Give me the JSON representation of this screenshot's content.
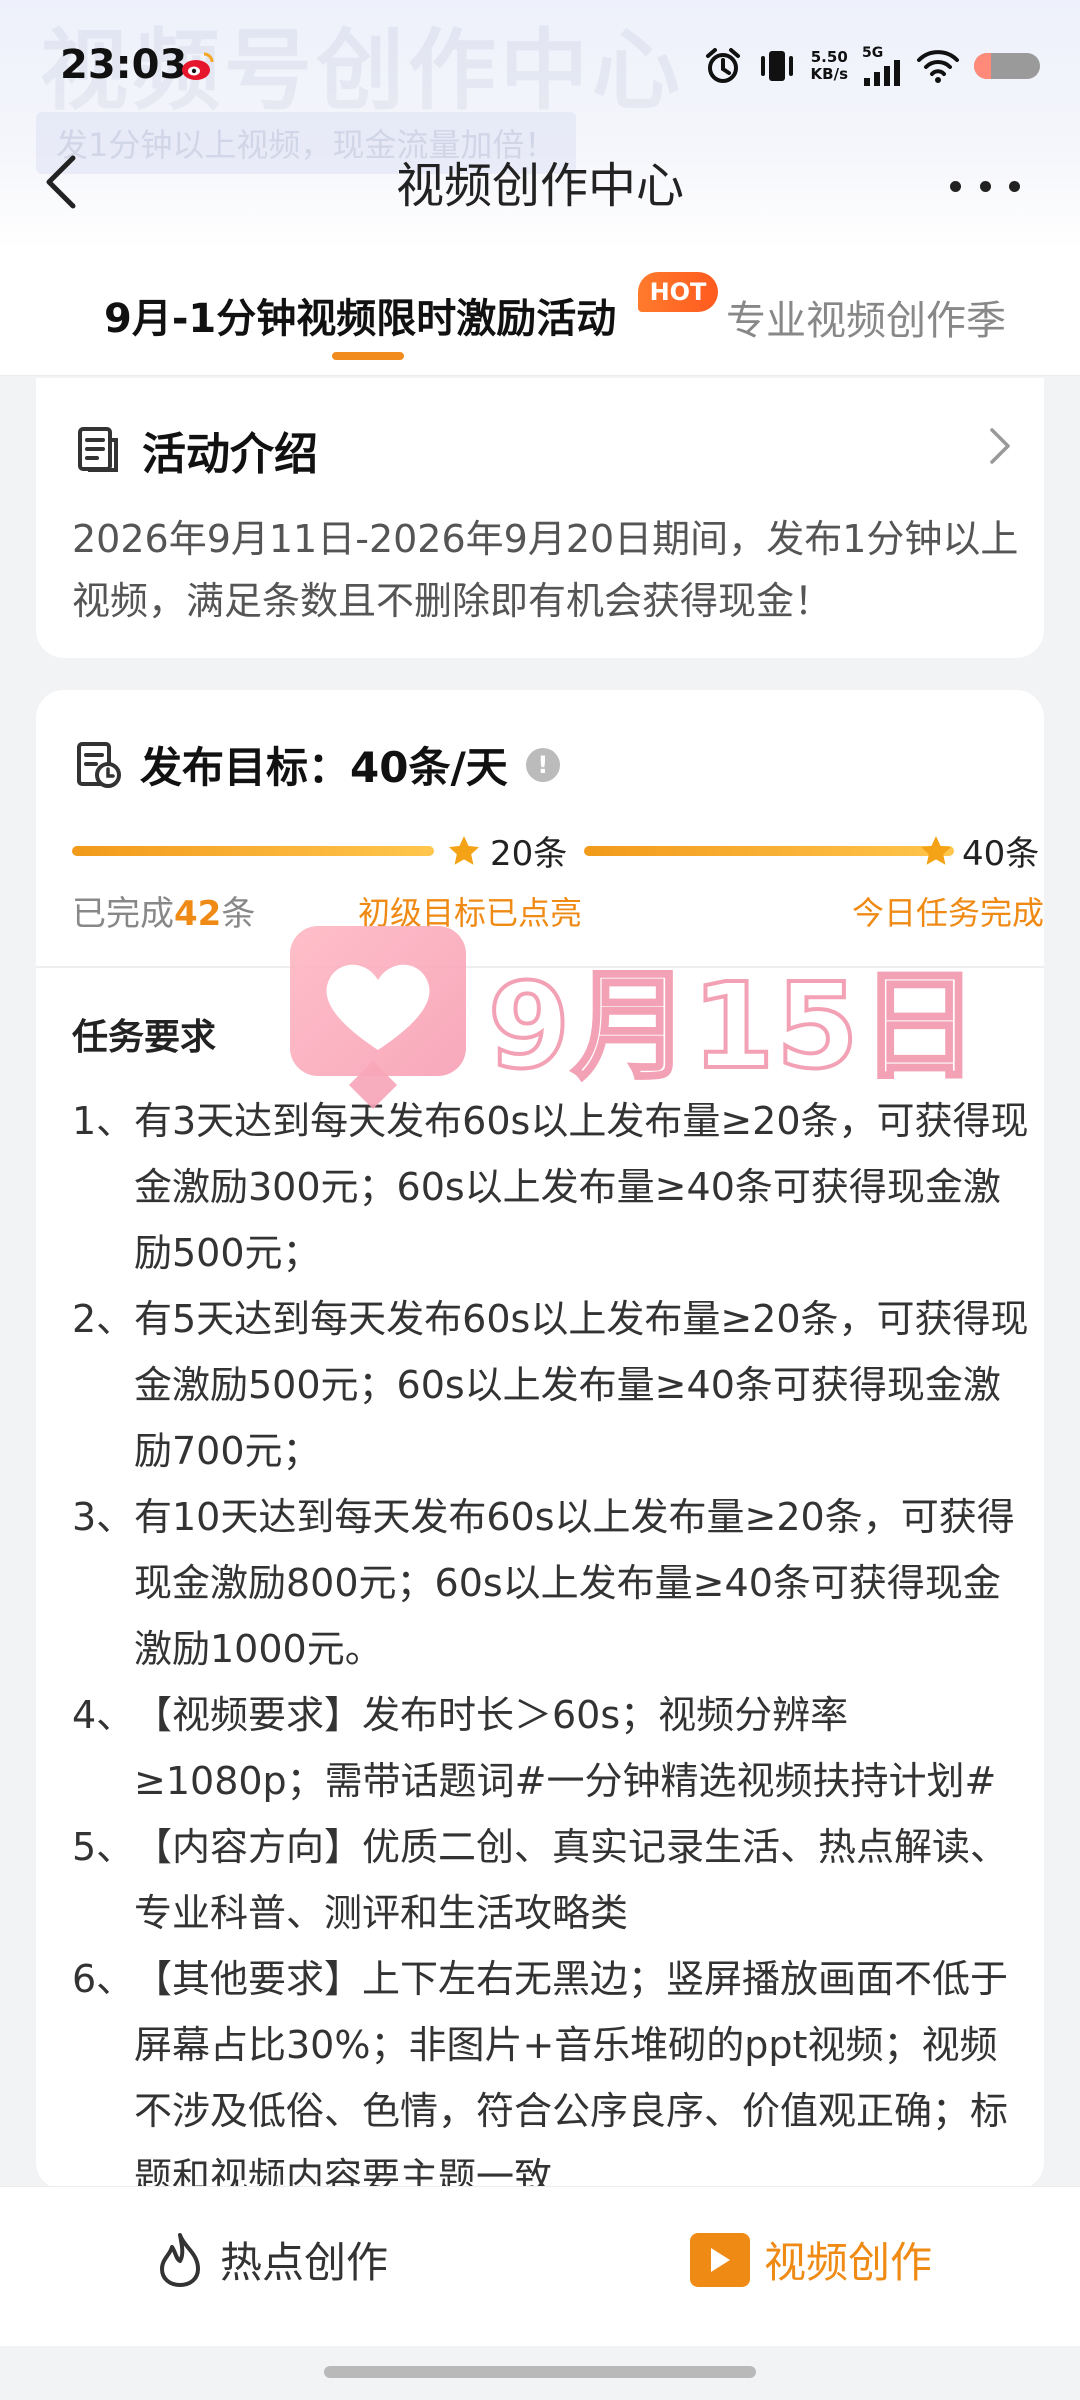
{
  "status_bar": {
    "time": "23:03",
    "net_speed_value": "5.50",
    "net_speed_unit": "KB/s",
    "network": "5G",
    "battery_level": 0.25,
    "battery_color": "#ff8a7a"
  },
  "banner": {
    "bg_title": "视频号创作中心",
    "bg_subtitle": "发1分钟以上视频，现金流量加倍！"
  },
  "nav": {
    "title": "视频创作中心"
  },
  "tabs": [
    {
      "label": "9月-1分钟视频限时激励活动",
      "active": true,
      "badge": "HOT"
    },
    {
      "label": "专业视频创作季",
      "active": false
    }
  ],
  "intro": {
    "title": "活动介绍",
    "description": "2026年9月11日-2026年9月20日期间，发布1分钟以上视频，满足条数且不删除即有机会获得现金！"
  },
  "goal": {
    "title": "发布目标：40条/天",
    "milestone_1": "20条",
    "milestone_2": "40条",
    "completed_prefix": "已完成",
    "completed_count": "42",
    "completed_suffix": "条",
    "status_primary": "初级目标已点亮",
    "status_done": "今日任务完成",
    "progress": 1.0
  },
  "requirements": {
    "title": "任务要求",
    "items": [
      {
        "num": "1、",
        "text": "有3天达到每天发布60s以上发布量≥20条，可获得现金激励300元；60s以上发布量≥40条可获得现金激励500元；"
      },
      {
        "num": "2、",
        "text": "有5天达到每天发布60s以上发布量≥20条，可获得现金激励500元；60s以上发布量≥40条可获得现金激励700元；"
      },
      {
        "num": "3、",
        "text": "有10天达到每天发布60s以上发布量≥20条，可获得现金激励800元；60s以上发布量≥40条可获得现金激励1000元。"
      },
      {
        "num": "4、",
        "text": "【视频要求】发布时长＞60s；视频分辨率≥1080p；需带话题词#一分钟精选视频扶持计划#"
      },
      {
        "num": "5、",
        "text": "【内容方向】优质二创、真实记录生活、热点解读、专业科普、测评和生活攻略类"
      },
      {
        "num": "6、",
        "text": "【其他要求】上下左右无黑边；竖屏播放画面不低于屏幕占比30%；非图片+音乐堆砌的ppt视频；视频不涉及低俗、色情，符合公序良序、价值观正确；标题和视频内容要主题一致"
      }
    ]
  },
  "stamp": {
    "date": "9月15日"
  },
  "bottom_bar": {
    "hot_label": "热点创作",
    "video_label": "视频创作"
  },
  "colors": {
    "accent": "#ef8a14",
    "hot_badge": "#ff5a1f",
    "stamp_pink": "#f7a0b4"
  },
  "icons": {
    "back": "chevron-left-icon",
    "more": "more-dots-icon",
    "intro": "document-icon",
    "goal": "clock-document-icon",
    "info": "info-icon",
    "star": "star-icon",
    "hot": "flame-icon",
    "video": "video-play-icon"
  }
}
